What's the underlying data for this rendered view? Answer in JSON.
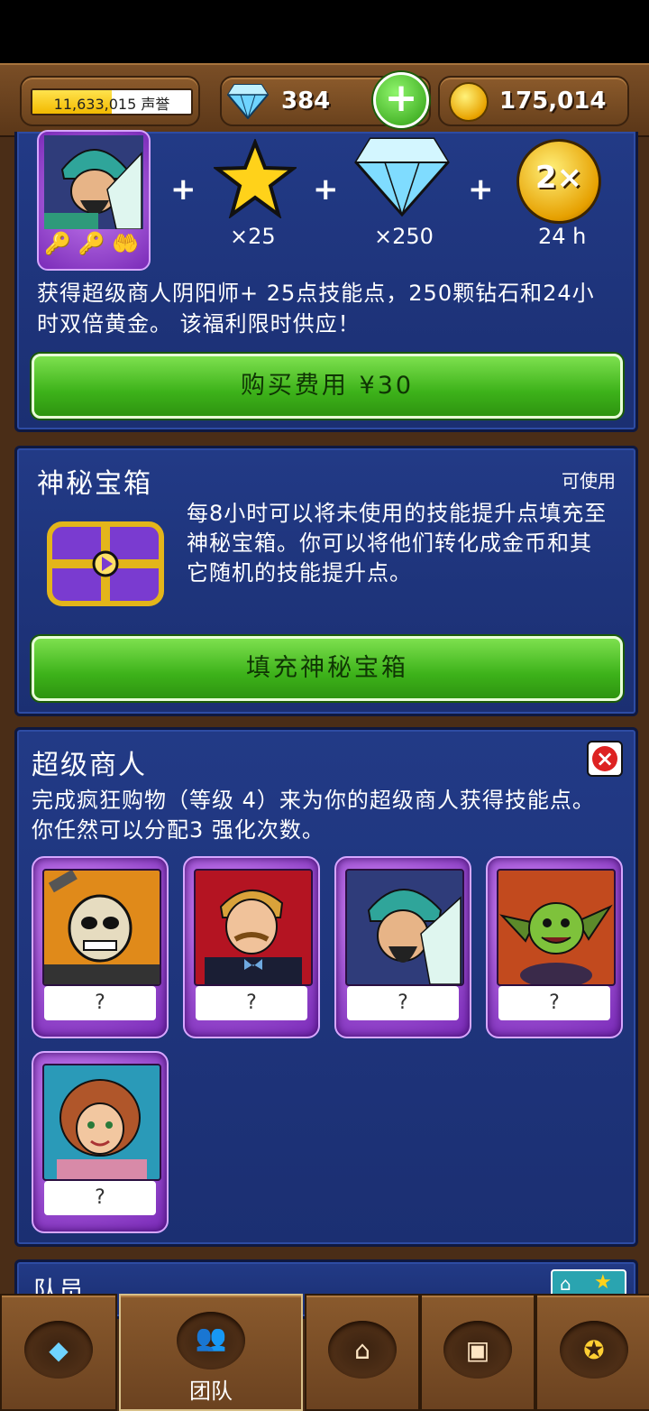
{
  "topbar": {
    "reputation_value": "11,633,015",
    "reputation_label": "声誉",
    "reputation_progress": 0.5,
    "diamonds": "384",
    "add_icon": "plus-icon",
    "gold": "175,014"
  },
  "offer": {
    "reward_star_qty": "×25",
    "reward_diamond_qty": "×250",
    "reward_double_badge": "2×",
    "reward_double_duration": "24 h",
    "description": "获得超级商人阴阳师+ 25点技能点，250颗钻石和24小时双倍黄金。 该福利限时供应！",
    "buy_button": "购买费用 ¥30"
  },
  "mystery": {
    "title": "神秘宝箱",
    "status": "可使用",
    "description": "每8小时可以将未使用的技能提升点填充至神秘宝箱。你可以将他们转化成金币和其它随机的技能提升点。",
    "fill_button": "填充神秘宝箱"
  },
  "supermerchant": {
    "title": "超级商人",
    "description": "完成疯狂购物（等级 4）来为你的超级商人获得技能点。 你任然可以分配3 强化次数。",
    "cards": [
      {
        "slot": "?"
      },
      {
        "slot": "?"
      },
      {
        "slot": "?"
      },
      {
        "slot": "?"
      },
      {
        "slot": "?"
      }
    ]
  },
  "team_section": {
    "title": "队员"
  },
  "bottom_nav": {
    "tabs": [
      {
        "icon": "diamond-icon",
        "label": ""
      },
      {
        "icon": "team-icon",
        "label": "团队"
      },
      {
        "icon": "shop-icon",
        "label": ""
      },
      {
        "icon": "chest-icon",
        "label": ""
      },
      {
        "icon": "medal-icon",
        "label": ""
      }
    ]
  },
  "colors": {
    "panel": "#1b2f72",
    "green_button": "#3db21a",
    "wood": "#6b4220",
    "card_purple": "#7a2bb8"
  }
}
